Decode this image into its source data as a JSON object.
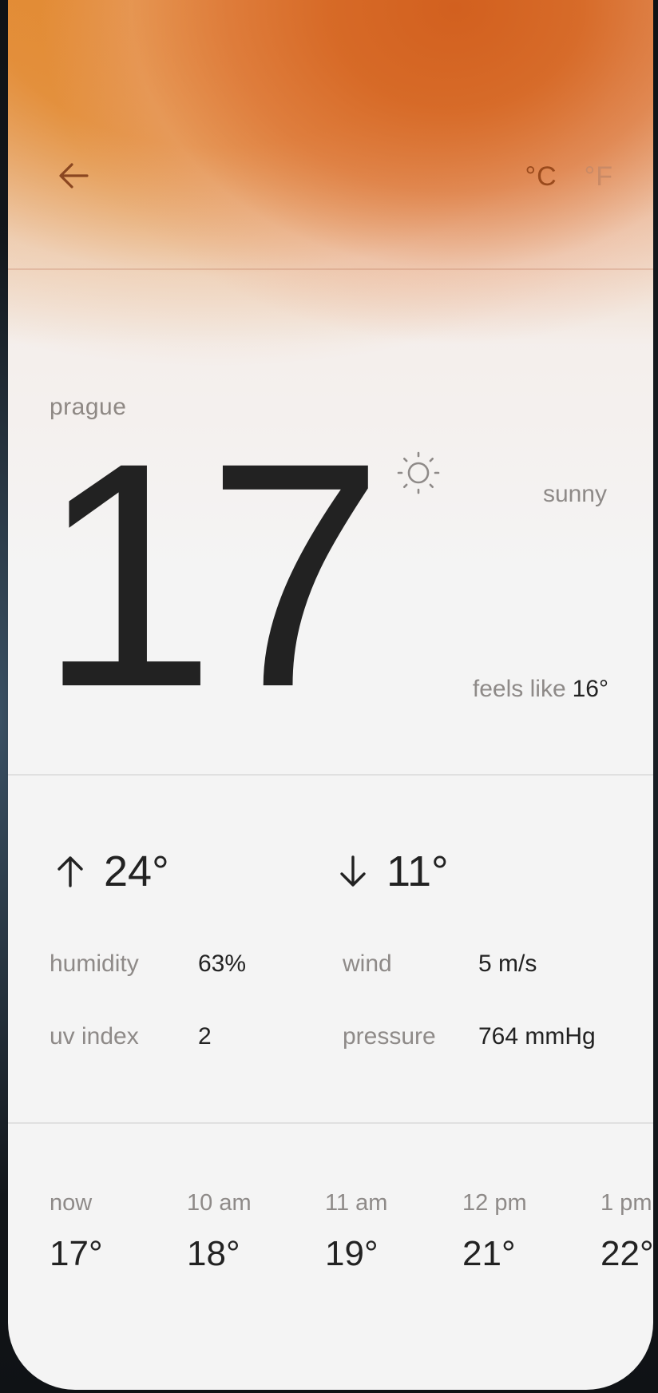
{
  "header": {
    "back_icon": "arrow-left-icon",
    "units": {
      "celsius": "°C",
      "fahrenheit": "°F",
      "active": "celsius"
    }
  },
  "current": {
    "city": "prague",
    "temperature": "17",
    "condition": "sunny",
    "condition_icon": "sun-icon",
    "feels_like_label": "feels like",
    "feels_like_value": "16°"
  },
  "range": {
    "high": "24°",
    "high_icon": "arrow-up-icon",
    "low": "11°",
    "low_icon": "arrow-down-icon"
  },
  "stats": {
    "humidity": {
      "label": "humidity",
      "value": "63%"
    },
    "wind": {
      "label": "wind",
      "value": "5 m/s"
    },
    "uv_index": {
      "label": "uv index",
      "value": "2"
    },
    "pressure": {
      "label": "pressure",
      "value": "764 mmHg"
    }
  },
  "hourly": [
    {
      "time": "now",
      "temp": "17°"
    },
    {
      "time": "10 am",
      "temp": "18°"
    },
    {
      "time": "11 am",
      "temp": "19°"
    },
    {
      "time": "12 pm",
      "temp": "21°"
    },
    {
      "time": "1 pm",
      "temp": "22°"
    }
  ],
  "colors": {
    "accent": "#d2601f",
    "active_unit": "#9a4a1c",
    "inactive_unit": "#c98a66",
    "primary_text": "#222222",
    "secondary_text": "#8e8a88"
  }
}
